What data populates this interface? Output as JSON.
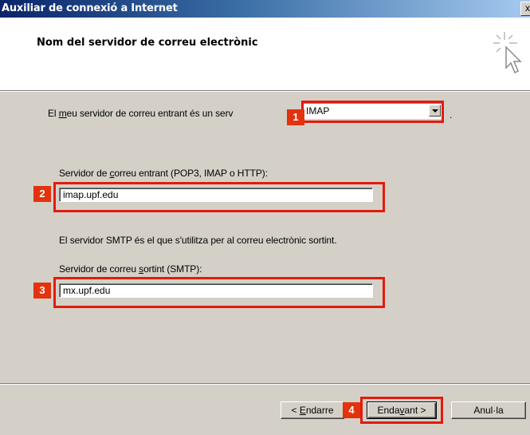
{
  "window": {
    "title": "Auxiliar de connexió a Internet",
    "close_glyph": "x"
  },
  "header": {
    "heading": "Nom del servidor de correu electrònic",
    "icon": "wizard-sparkle-cursor-icon"
  },
  "incoming_type": {
    "label_pre": "El ",
    "label_underlined": "m",
    "label_post": "eu servidor de correu entrant és un serv",
    "selected": "IMAP",
    "trailing": "."
  },
  "incoming_server": {
    "label_pre": "Servidor de ",
    "label_underlined": "c",
    "label_post": "orreu entrant (POP3, IMAP o HTTP):",
    "value": "imap.upf.edu"
  },
  "smtp_note": "El servidor SMTP és el que s'utilitza per al correu electrònic sortint.",
  "outgoing_server": {
    "label_pre": "Servidor de correu ",
    "label_underlined": "s",
    "label_post": "ortint (SMTP):",
    "value": "mx.upf.edu"
  },
  "callouts": [
    "1",
    "2",
    "3",
    "4"
  ],
  "buttons": {
    "back": {
      "pre": "< ",
      "underlined": "E",
      "post": "ndarre"
    },
    "next": {
      "pre": "Enda",
      "underlined": "v",
      "post": "ant >"
    },
    "cancel": "Anul·la"
  },
  "colors": {
    "callout": "#e21b0c",
    "titlebar_start": "#0a246a",
    "dialog_bg": "#d4d0c8"
  }
}
